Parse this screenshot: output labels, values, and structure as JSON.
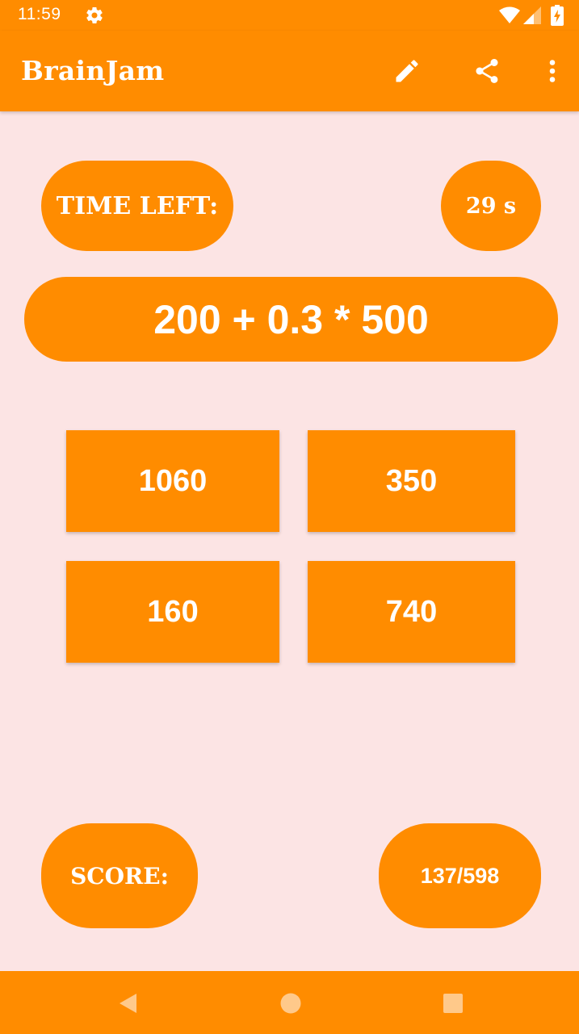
{
  "status_bar": {
    "time": "11:59",
    "icons": [
      "settings-icon",
      "wifi-icon",
      "signal-icon",
      "battery-charging-icon"
    ]
  },
  "app_bar": {
    "title": "BrainJam",
    "actions": [
      "edit-icon",
      "share-icon",
      "more-vert-icon"
    ]
  },
  "game": {
    "time_left_label": "TIME LEFT:",
    "timer_value": "29 s",
    "question": "200 + 0.3 * 500",
    "answers": [
      "1060",
      "350",
      "160",
      "740"
    ],
    "score_label": "SCORE:",
    "score_value": "137/598"
  },
  "nav_bar": {
    "buttons": [
      "back-icon",
      "home-icon",
      "recents-icon"
    ]
  },
  "colors": {
    "accent": "#ff8c00",
    "background": "#fce4e4",
    "text_on_accent": "#ffffff"
  }
}
